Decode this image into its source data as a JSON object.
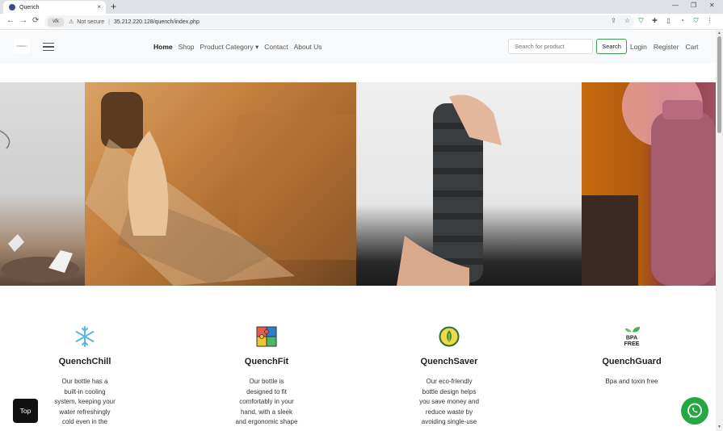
{
  "browser": {
    "tab_title": "Quench",
    "tab_close": "×",
    "new_tab": "+",
    "win_min": "—",
    "win_max": "❐",
    "win_close": "✕",
    "back": "←",
    "forward": "→",
    "reload": "⟳",
    "site_badge": "vfk",
    "warn": "⚠",
    "not_secure": "Not secure",
    "separator": "|",
    "url": "35.212.220.128/quench/index.php"
  },
  "nav": {
    "logo_text": "QUENCH",
    "links": [
      "Home",
      "Shop",
      "Product Category ▾",
      "Contact",
      "About Us"
    ],
    "search_placeholder": "Search for product",
    "search_button": "Search",
    "right_links": [
      "Login",
      "Register",
      "Cart"
    ]
  },
  "features": [
    {
      "icon": "snowflake-icon",
      "title": "QuenchChill",
      "desc_lines": [
        "Our bottle has a",
        "built-in cooling",
        "system, keeping your",
        "water refreshingly",
        "cold even in the"
      ]
    },
    {
      "icon": "puzzle-icon",
      "title": "QuenchFit",
      "desc_lines": [
        "Our bottle is",
        "designed to fit",
        "comfortably in your",
        "hand, with a sleek",
        "and ergonomic shape"
      ]
    },
    {
      "icon": "eco-drop-icon",
      "title": "QuenchSaver",
      "desc_lines": [
        "Our eco-friendly",
        "bottle design helps",
        "you save money and",
        "reduce waste by",
        "avoiding single-use"
      ]
    },
    {
      "icon": "bpa-free-icon",
      "title": "QuenchGuard",
      "desc_lines": [
        "Bpa and toxin free"
      ]
    }
  ],
  "bpa_label": [
    "BPA",
    "FREE"
  ],
  "top_button": "Top",
  "colors": {
    "accent_green": "#3c9a57",
    "whatsapp": "#25a744"
  }
}
